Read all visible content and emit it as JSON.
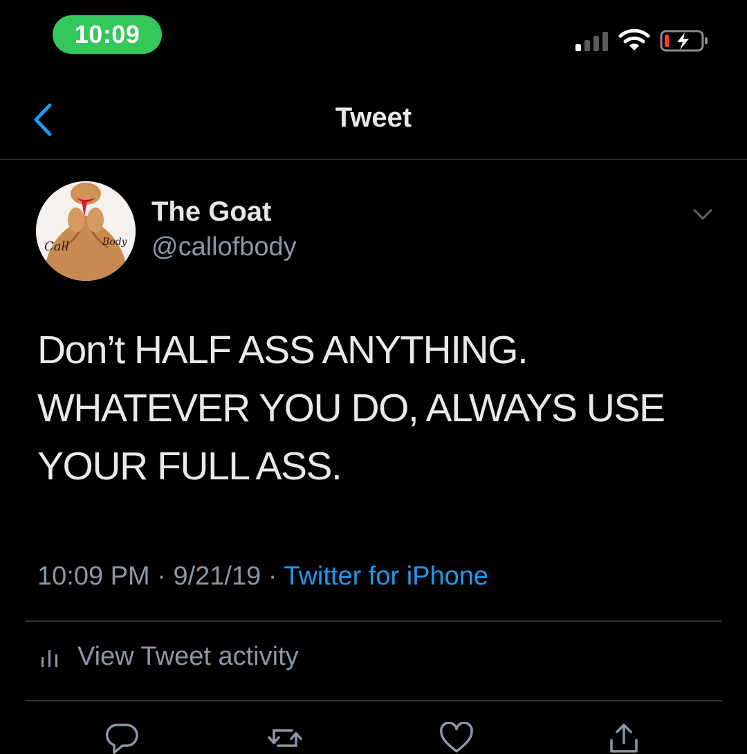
{
  "status_bar": {
    "time": "10:09",
    "time_pill_color": "#34c759",
    "icons": [
      "signal-icon",
      "wifi-icon",
      "battery-charging-icon"
    ]
  },
  "nav": {
    "back_icon": "chevron-left-icon",
    "title": "Tweet",
    "accent_color": "#1d9bf0"
  },
  "tweet": {
    "author": {
      "display_name": "The Goat",
      "handle": "@callofbody",
      "avatar_icon": "avatar-illustration"
    },
    "menu_icon": "chevron-down-icon",
    "text": "Don’t HALF ASS ANYTHING.\nWHATEVER YOU DO, ALWAYS USE\nYOUR FULL ASS.",
    "time": "10:09 PM",
    "separator": " · ",
    "date": "9/21/19",
    "source": "Twitter for iPhone"
  },
  "activity": {
    "icon": "bar-chart-icon",
    "label": "View Tweet activity"
  },
  "actions": [
    {
      "icon": "reply-icon"
    },
    {
      "icon": "retweet-icon"
    },
    {
      "icon": "like-icon"
    },
    {
      "icon": "share-icon"
    }
  ]
}
